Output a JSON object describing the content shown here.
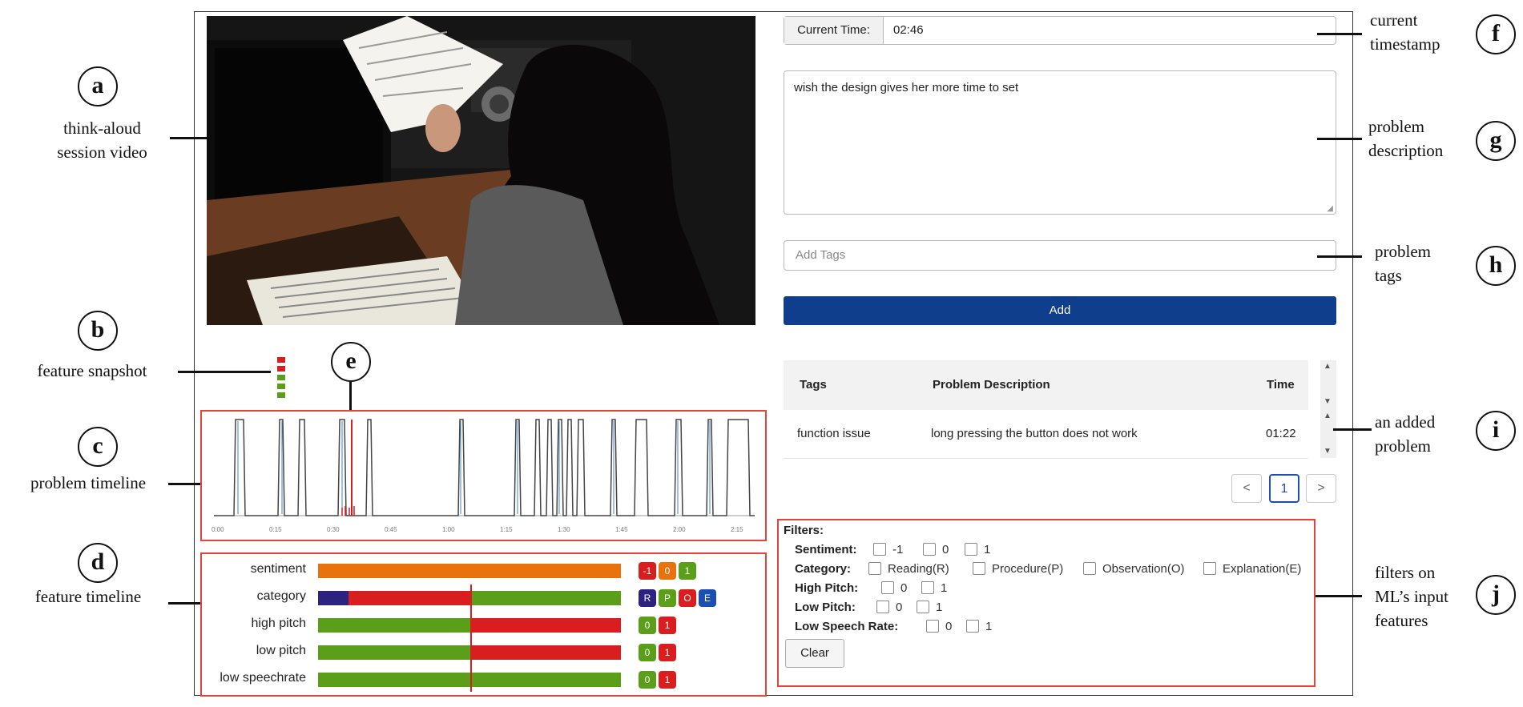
{
  "annotations": {
    "a": {
      "letter": "a",
      "line1": "think-aloud",
      "line2": "session video"
    },
    "b": {
      "letter": "b",
      "line1": "feature snapshot"
    },
    "c": {
      "letter": "c",
      "line1": "problem timeline"
    },
    "d": {
      "letter": "d",
      "line1": "feature timeline"
    },
    "e": {
      "letter": "e"
    },
    "f": {
      "letter": "f",
      "line1": "current",
      "line2": "timestamp"
    },
    "g": {
      "letter": "g",
      "line1": "problem",
      "line2": "description"
    },
    "h": {
      "letter": "h",
      "line1": "problem",
      "line2": "tags"
    },
    "i": {
      "letter": "i",
      "line1": "an added",
      "line2": "problem"
    },
    "j": {
      "letter": "j",
      "line1": "filters on",
      "line2": "ML’s input",
      "line3": "features"
    }
  },
  "current_time": {
    "label": "Current Time:",
    "value": "02:46"
  },
  "problem_description": "wish the design gives her more time to set",
  "tags_input": {
    "placeholder": "Add Tags"
  },
  "add_button": "Add",
  "problems_table": {
    "headers": [
      "Tags",
      "Problem Description",
      "Time"
    ],
    "rows": [
      {
        "tags": "function issue",
        "description": "long pressing the button does not work",
        "time": "01:22"
      }
    ]
  },
  "pagination": {
    "prev": "<",
    "current": "1",
    "next": ">"
  },
  "filters": {
    "title": "Filters:",
    "sentiment": {
      "label": "Sentiment:",
      "options": [
        "-1",
        "0",
        "1"
      ]
    },
    "category": {
      "label": "Category:",
      "options": [
        "Reading(R)",
        "Procedure(P)",
        "Observation(O)",
        "Explanation(E)"
      ]
    },
    "high_pitch": {
      "label": "High Pitch:",
      "options": [
        "0",
        "1"
      ]
    },
    "low_pitch": {
      "label": "Low Pitch:",
      "options": [
        "0",
        "1"
      ]
    },
    "low_speech_rate": {
      "label": "Low Speech Rate:",
      "options": [
        "0",
        "1"
      ]
    },
    "clear_button": "Clear"
  },
  "feature_timeline": {
    "rows": [
      {
        "label": "sentiment",
        "badges": [
          "-1",
          "0",
          "1"
        ]
      },
      {
        "label": "category",
        "badges": [
          "R",
          "P",
          "O",
          "E"
        ]
      },
      {
        "label": "high pitch",
        "badges": [
          "0",
          "1"
        ]
      },
      {
        "label": "low pitch",
        "badges": [
          "0",
          "1"
        ]
      },
      {
        "label": "low speechrate",
        "badges": [
          "0",
          "1"
        ]
      }
    ]
  },
  "problem_timeline_ticks": [
    "0:00",
    "0:15",
    "0:30",
    "0:45",
    "1:00",
    "1:15",
    "1:30",
    "1:45",
    "2:00",
    "2:15"
  ],
  "colors": {
    "accent_red": "#e0473a",
    "add_button": "#0f3f8c",
    "green": "#5a9e1a",
    "red": "#d81e1e",
    "orange": "#e8730e",
    "navy": "#2c2380",
    "blue": "#1c4fb0"
  }
}
